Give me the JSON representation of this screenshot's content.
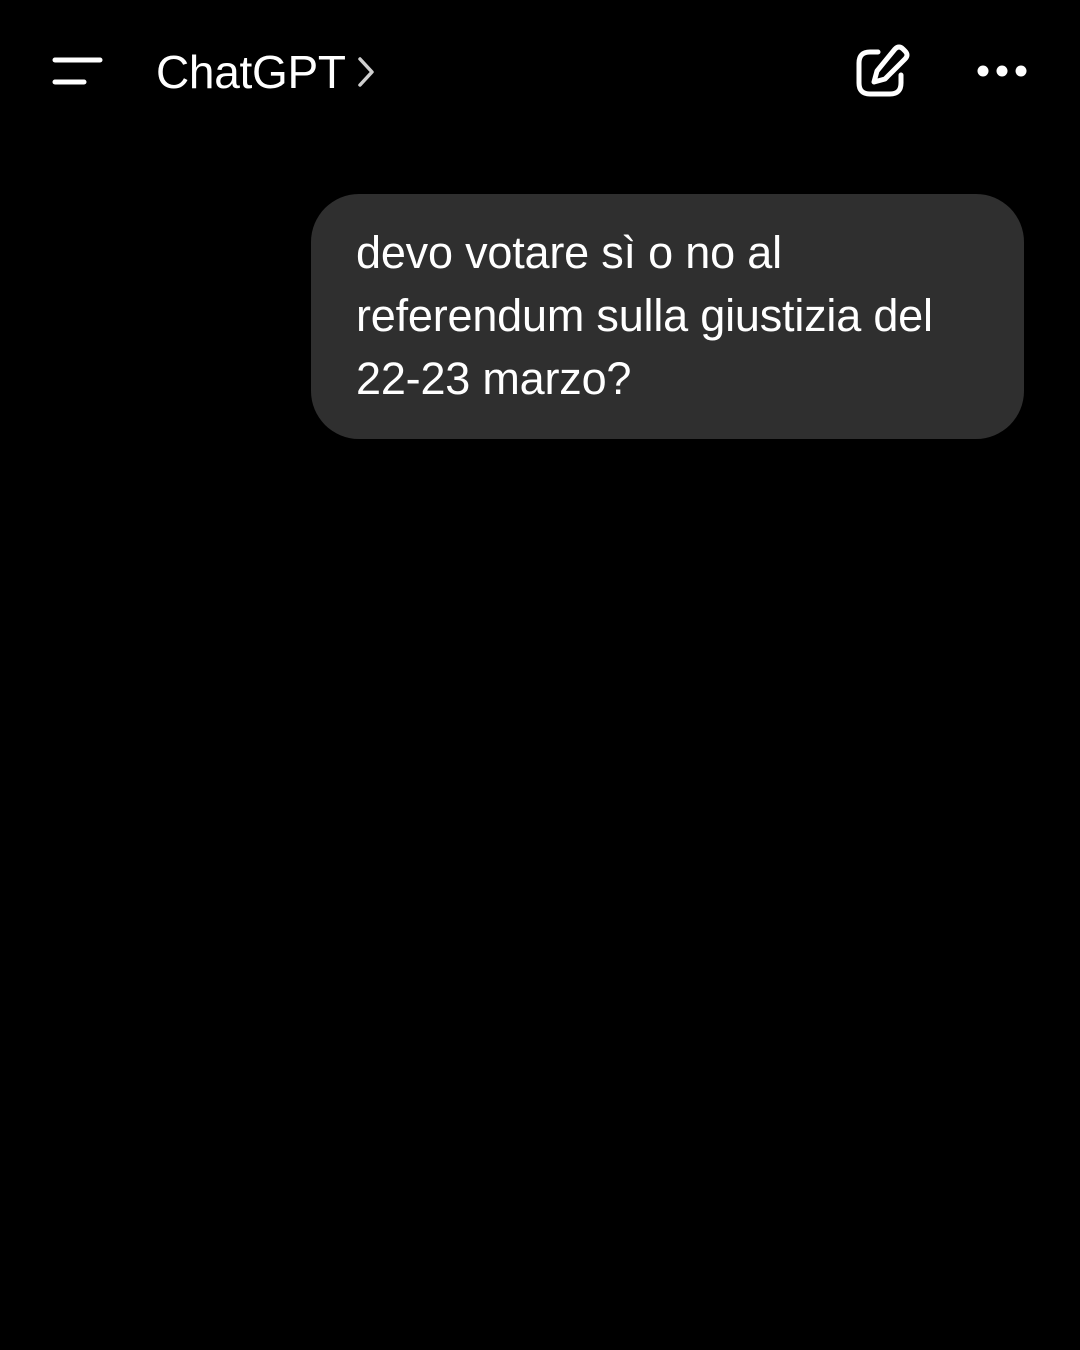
{
  "header": {
    "title": "ChatGPT",
    "menu_icon": "hamburger-menu-icon",
    "chevron_icon": "chevron-right-icon",
    "new_chat_icon": "edit-pencil-square-icon",
    "more_icon": "ellipsis-icon"
  },
  "conversation": {
    "messages": [
      {
        "role": "user",
        "text": "devo votare sì o no al\nreferendum sulla giustizia del\n22-23 marzo?"
      }
    ]
  },
  "colors": {
    "background": "#000000",
    "bubble": "#2f2f2f",
    "text": "#ffffff"
  }
}
